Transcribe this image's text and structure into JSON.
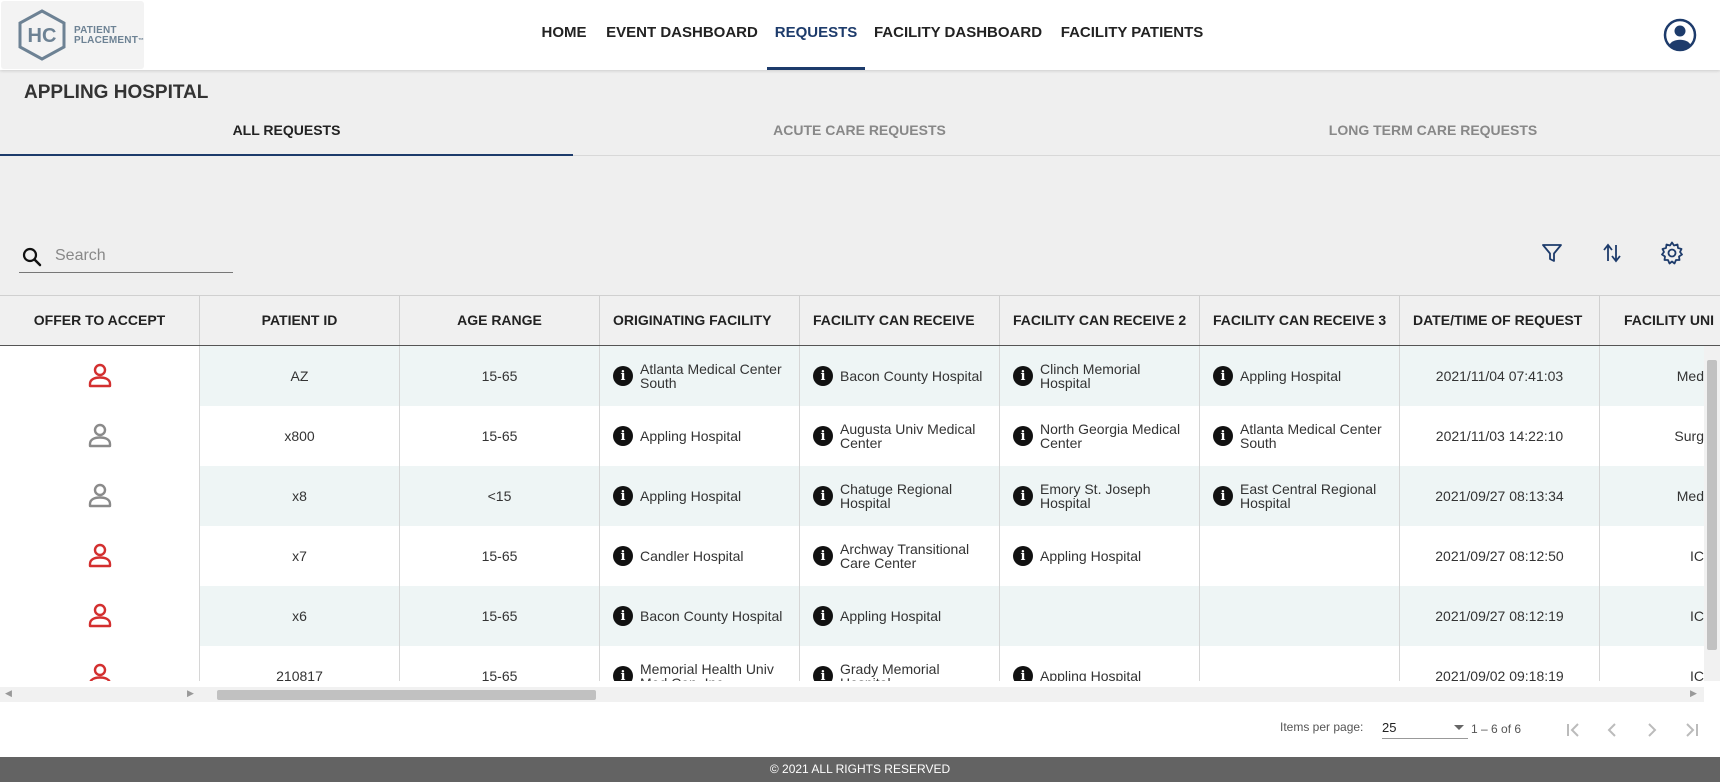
{
  "logo": {
    "initials": "HC",
    "line1": "PATIENT",
    "line2": "PLACEMENT",
    "tm": "™"
  },
  "nav": {
    "items": [
      {
        "label": "HOME"
      },
      {
        "label": "EVENT DASHBOARD"
      },
      {
        "label": "REQUESTS"
      },
      {
        "label": "FACILITY DASHBOARD"
      },
      {
        "label": "FACILITY PATIENTS"
      }
    ],
    "active": "REQUESTS"
  },
  "page_title": "APPLING HOSPITAL",
  "tabs": [
    {
      "label": "ALL REQUESTS"
    },
    {
      "label": "ACUTE CARE REQUESTS"
    },
    {
      "label": "LONG TERM CARE REQUESTS"
    }
  ],
  "active_tab": "ALL REQUESTS",
  "search": {
    "placeholder": "Search",
    "value": ""
  },
  "toolbar_icons": [
    "filter-icon",
    "sort-icon",
    "settings-icon"
  ],
  "table": {
    "columns": [
      "OFFER TO ACCEPT",
      "PATIENT ID",
      "AGE RANGE",
      "ORIGINATING FACILITY",
      "FACILITY CAN RECEIVE",
      "FACILITY CAN RECEIVE 2",
      "FACILITY CAN RECEIVE 3",
      "DATE/TIME OF REQUEST",
      "FACILITY UNI"
    ],
    "rows": [
      {
        "offer_status": "red",
        "patient_id": "AZ",
        "age_range": "15-65",
        "originating": "Atlanta Medical Center South",
        "receive1": "Bacon County Hospital",
        "receive2": "Clinch Memorial Hospital",
        "receive3": "Appling Hospital",
        "datetime": "2021/11/04 07:41:03",
        "unit": "Med"
      },
      {
        "offer_status": "gray",
        "patient_id": "x800",
        "age_range": "15-65",
        "originating": "Appling Hospital",
        "receive1": "Augusta Univ Medical Center",
        "receive2": "North Georgia Medical Center",
        "receive3": "Atlanta Medical Center South",
        "datetime": "2021/11/03 14:22:10",
        "unit": "Surg"
      },
      {
        "offer_status": "gray",
        "patient_id": "x8",
        "age_range": "<15",
        "originating": "Appling Hospital",
        "receive1": "Chatuge Regional Hospital",
        "receive2": "Emory St. Joseph Hospital",
        "receive3": "East Central Regional Hospital",
        "datetime": "2021/09/27 08:13:34",
        "unit": "Med"
      },
      {
        "offer_status": "red",
        "patient_id": "x7",
        "age_range": "15-65",
        "originating": "Candler Hospital",
        "receive1": "Archway Transitional Care Center",
        "receive2": "Appling Hospital",
        "receive3": "",
        "datetime": "2021/09/27 08:12:50",
        "unit": "IC"
      },
      {
        "offer_status": "red",
        "patient_id": "x6",
        "age_range": "15-65",
        "originating": "Bacon County Hospital",
        "receive1": "Appling Hospital",
        "receive2": "",
        "receive3": "",
        "datetime": "2021/09/27 08:12:19",
        "unit": "IC"
      },
      {
        "offer_status": "red",
        "patient_id": "210817",
        "age_range": "15-65",
        "originating": "Memorial Health Univ Med Cen, Inc",
        "receive1": "Grady Memorial Hospital",
        "receive2": "Appling Hospital",
        "receive3": "",
        "datetime": "2021/09/02 09:18:19",
        "unit": "IC"
      }
    ]
  },
  "colors": {
    "brand_navy": "#1d3b6b",
    "offer_red": "#d32f2f",
    "offer_gray": "#8a8a8a",
    "row_alt": "#eef5f5",
    "footer_bg": "#636363"
  },
  "paginator": {
    "items_per_page_label": "Items per page:",
    "items_per_page": "25",
    "range": "1 – 6 of 6"
  },
  "footer": "© 2021 ALL RIGHTS RESERVED"
}
